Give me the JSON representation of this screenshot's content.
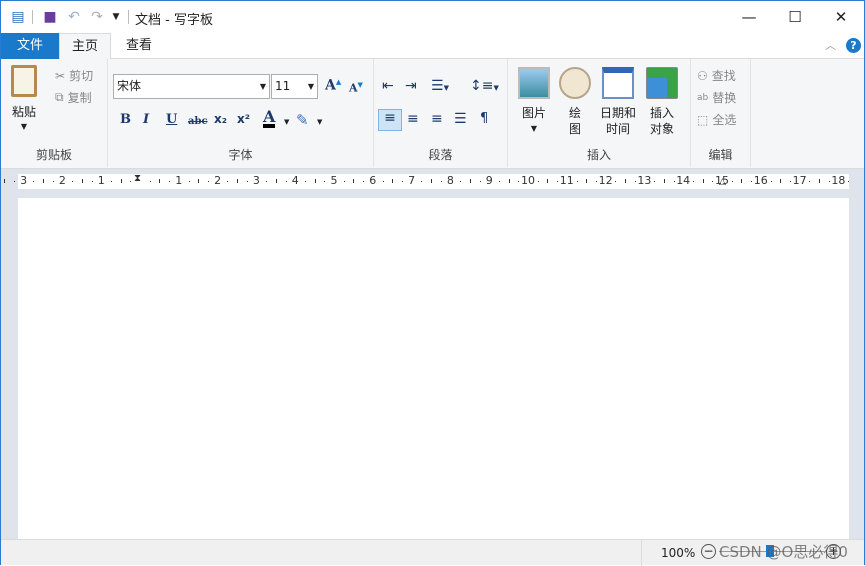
{
  "titlebar": {
    "title": "文档 - 写字板",
    "icons": [
      "wordpad-icon",
      "save-icon",
      "undo-icon",
      "redo-icon",
      "customize-dropdown-icon"
    ],
    "minimize": "—",
    "maximize": "☐",
    "close": "✕"
  },
  "tabs": [
    {
      "label": "文件"
    },
    {
      "label": "主页",
      "active": true
    },
    {
      "label": "查看"
    }
  ],
  "ribbon": {
    "clipboard": {
      "label": "剪贴板",
      "paste": "粘贴",
      "cut": "剪切",
      "copy": "复制"
    },
    "font": {
      "label": "字体",
      "family": "宋体",
      "size": "11",
      "buttons": [
        "B",
        "I",
        "U",
        "abc",
        "x₂",
        "x²",
        "A"
      ]
    },
    "paragraph": {
      "label": "段落"
    },
    "insert": {
      "label": "插入",
      "picture": "图片",
      "paint": "绘图",
      "datetime": "日期和时间",
      "object": "插入对象"
    },
    "editing": {
      "label": "编辑",
      "find": "查找",
      "replace": "替换",
      "select_all": "全选"
    }
  },
  "ruler": {
    "left_labels": [
      "3",
      "2",
      "1"
    ],
    "right_labels": [
      "1",
      "2",
      "3",
      "4",
      "5",
      "6",
      "7",
      "8",
      "9",
      "10",
      "11",
      "12",
      "13",
      "14",
      "15",
      "16",
      "17",
      "18"
    ]
  },
  "status": {
    "zoom": "100%"
  },
  "watermark": "CSDN @O思必得0",
  "colors": {
    "accent": "#1979ca",
    "ribbon_bg": "#f5f6f7",
    "workspace_bg": "#dfe3ec"
  }
}
